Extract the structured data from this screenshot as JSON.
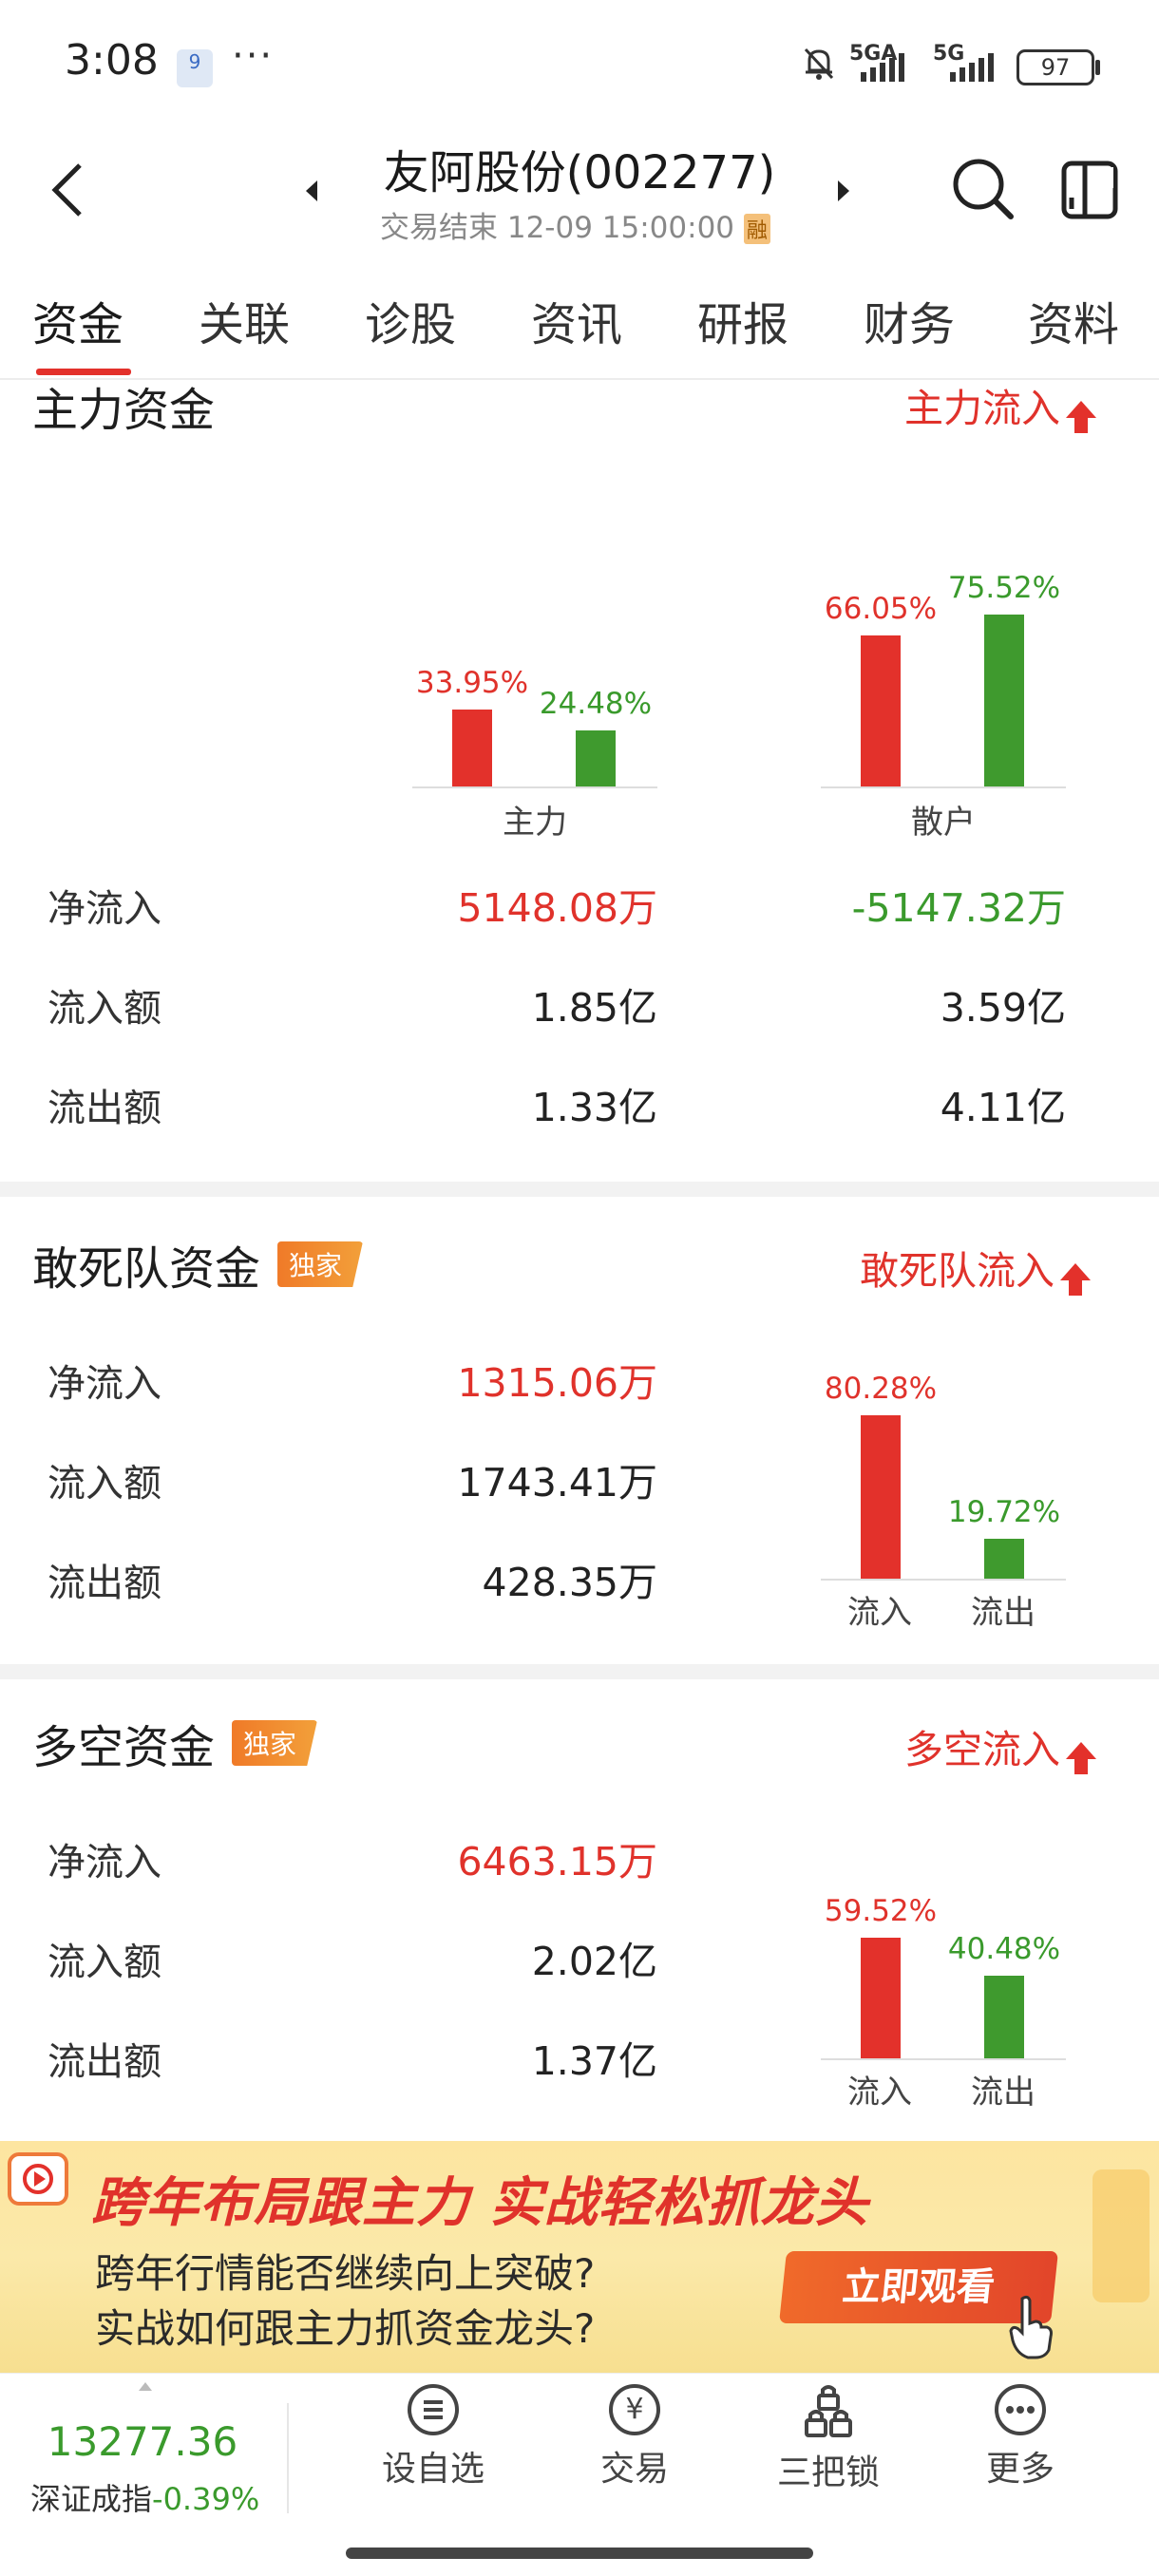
{
  "status_bar": {
    "time": "3:08",
    "dots": "···",
    "net1": "5GA",
    "net2": "5G",
    "battery": "97",
    "badge": "9"
  },
  "header": {
    "title": "友阿股份(002277)",
    "subtitle": "交易结束 12-09 15:00:00",
    "rong": "融"
  },
  "tabs": [
    "资金",
    "关联",
    "诊股",
    "资讯",
    "研报",
    "财务",
    "资料"
  ],
  "main_flow": {
    "title": "主力资金",
    "trend": "主力流入",
    "groups": [
      {
        "name": "主力",
        "in_pct": "33.95%",
        "out_pct": "24.48%",
        "in_value": 33.95,
        "out_value": 24.48
      },
      {
        "name": "散户",
        "in_pct": "66.05%",
        "out_pct": "75.52%",
        "in_value": 66.05,
        "out_value": 75.52
      }
    ],
    "rows": [
      {
        "label": "净流入",
        "main": "5148.08万",
        "retail": "-5147.32万"
      },
      {
        "label": "流入额",
        "main": "1.85亿",
        "retail": "3.59亿"
      },
      {
        "label": "流出额",
        "main": "1.33亿",
        "retail": "4.11亿"
      }
    ]
  },
  "dare_flow": {
    "title": "敢死队资金",
    "tag": "独家",
    "trend": "敢死队流入",
    "rows": [
      {
        "label": "净流入",
        "value": "1315.06万"
      },
      {
        "label": "流入额",
        "value": "1743.41万"
      },
      {
        "label": "流出额",
        "value": "428.35万"
      }
    ],
    "bars": {
      "in_pct": "80.28%",
      "out_pct": "19.72%",
      "in_value": 80.28,
      "out_value": 19.72,
      "in_label": "流入",
      "out_label": "流出"
    }
  },
  "longshort_flow": {
    "title": "多空资金",
    "tag": "独家",
    "trend": "多空流入",
    "rows": [
      {
        "label": "净流入",
        "value": "6463.15万"
      },
      {
        "label": "流入额",
        "value": "2.02亿"
      },
      {
        "label": "流出额",
        "value": "1.37亿"
      }
    ],
    "bars": {
      "in_pct": "59.52%",
      "out_pct": "40.48%",
      "in_value": 59.52,
      "out_value": 40.48,
      "in_label": "流入",
      "out_label": "流出"
    }
  },
  "banner": {
    "headline": "跨年布局跟主力 实战轻松抓龙头",
    "line1": "跨年行情能否继续向上突破?",
    "line2": "实战如何跟主力抓资金龙头?",
    "button": "立即观看"
  },
  "bottom": {
    "index_value": "13277.36",
    "index_name": "深证成指",
    "index_change": "-0.39%",
    "nav": [
      "设自选",
      "交易",
      "三把锁",
      "更多"
    ],
    "trade_icon": "¥"
  }
}
